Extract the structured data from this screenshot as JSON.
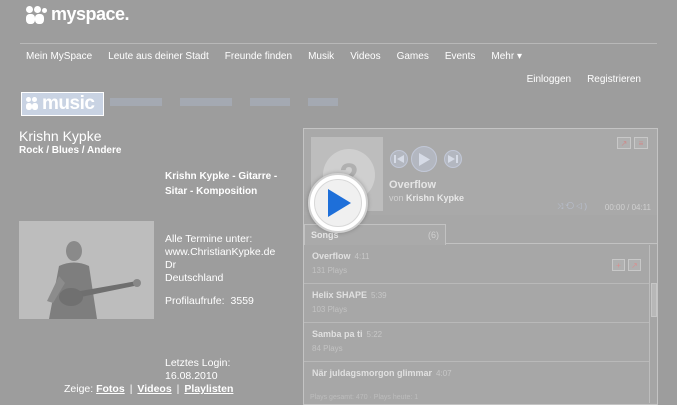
{
  "header": {
    "logo_text": "myspace.",
    "nav": [
      "Mein MySpace",
      "Leute aus deiner Stadt",
      "Freunde finden",
      "Musik",
      "Videos",
      "Games",
      "Events",
      "Mehr ▾"
    ],
    "login": "Einloggen",
    "register": "Registrieren"
  },
  "music_logo": "music",
  "profile": {
    "name": "Krishn Kypke",
    "genre": "Rock / Blues / Andere",
    "headline": "Krishn Kypke - Gitarre - Sitar - Komposition",
    "info_lines": [
      "Alle Termine unter:",
      "www.ChristianKypke.de",
      "Dr",
      "Deutschland"
    ],
    "views_label": "Profilaufrufe:",
    "views_value": "3559",
    "last_login_label": "Letztes Login:",
    "last_login_date": "16.08.2010",
    "show_label": "Zeige:",
    "show_links": [
      "Fotos",
      "Videos",
      "Playlisten"
    ]
  },
  "player": {
    "now_playing_title": "Overflow",
    "by_prefix": "von",
    "by_artist": "Krishn Kypke",
    "time": "00:00 / 04:11",
    "tab_label": "Songs",
    "tab_count": "(6)",
    "songs": [
      {
        "title": "Overflow",
        "duration": "4:11",
        "plays": "131 Plays"
      },
      {
        "title": "Helix SHAPE",
        "duration": "5:39",
        "plays": "103 Plays"
      },
      {
        "title": "Samba pa ti",
        "duration": "5:22",
        "plays": "84 Plays"
      },
      {
        "title": "När juldagsmorgon glimmar",
        "duration": "4:07",
        "plays": ""
      }
    ],
    "footer": "Plays gesamt: 470 · Plays heute: 1"
  },
  "colors": {
    "background": "#9d9d9d",
    "accent": "#4a90d9"
  }
}
